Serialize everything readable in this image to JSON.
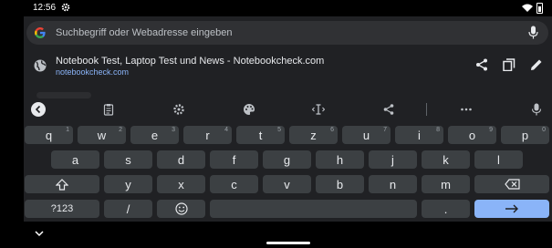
{
  "status_bar": {
    "time": "12:56"
  },
  "search": {
    "placeholder": "Suchbegriff oder Webadresse eingeben"
  },
  "suggestion": {
    "title": "Notebook Test, Laptop Test und News - Notebookcheck.com",
    "url": "notebookcheck.com"
  },
  "keyboard": {
    "row1": [
      {
        "label": "q",
        "hint": "1"
      },
      {
        "label": "w",
        "hint": "2"
      },
      {
        "label": "e",
        "hint": "3"
      },
      {
        "label": "r",
        "hint": "4"
      },
      {
        "label": "t",
        "hint": "5"
      },
      {
        "label": "z",
        "hint": "6"
      },
      {
        "label": "u",
        "hint": "7"
      },
      {
        "label": "i",
        "hint": "8"
      },
      {
        "label": "o",
        "hint": "9"
      },
      {
        "label": "p",
        "hint": "0"
      }
    ],
    "row2": [
      "a",
      "s",
      "d",
      "f",
      "g",
      "h",
      "j",
      "k",
      "l"
    ],
    "row3": [
      "y",
      "x",
      "c",
      "v",
      "b",
      "n",
      "m"
    ],
    "symbols_label": "?123",
    "slash_label": "/",
    "period_label": ".",
    "icons": {
      "toolbar": [
        "chevron-left-icon",
        "clipboard-icon",
        "settings-icon",
        "palette-icon",
        "text-cursor-icon",
        "share-icon",
        "more-icon",
        "mic-icon"
      ],
      "shift": "shift-icon",
      "backspace": "backspace-icon",
      "emoji": "emoji-icon",
      "enter": "arrow-right-icon"
    }
  },
  "colors": {
    "panel": "#202124",
    "key": "#3c4043",
    "accent": "#8ab4f8",
    "link": "#8ab4f8"
  }
}
